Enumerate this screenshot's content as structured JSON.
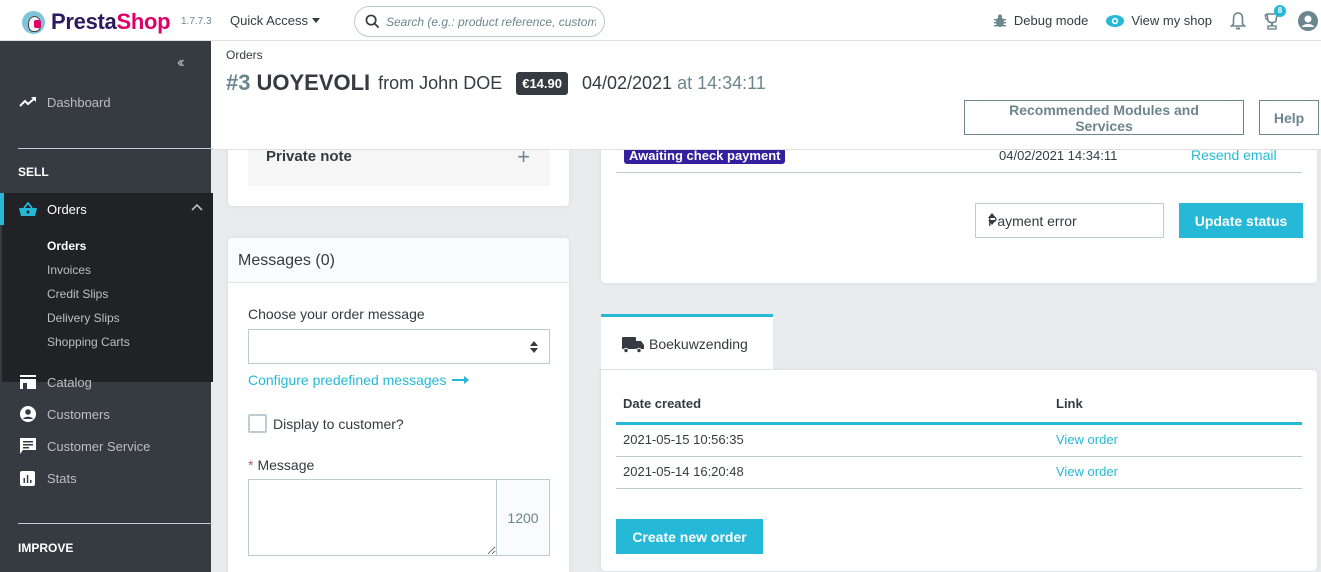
{
  "header": {
    "logo_brand": "Presta",
    "logo_brand_accent": "Shop",
    "version": "1.7.7.3",
    "quick_access": "Quick Access",
    "search_placeholder": "Search (e.g.: product reference, customer name…)",
    "debug_mode": "Debug mode",
    "view_shop": "View my shop",
    "notifications_badge": "8"
  },
  "sidebar": {
    "collapse_icon": "double-chevron-left",
    "dashboard": "Dashboard",
    "sell_title": "SELL",
    "orders": "Orders",
    "orders_sub": [
      "Orders",
      "Invoices",
      "Credit Slips",
      "Delivery Slips",
      "Shopping Carts"
    ],
    "catalog": "Catalog",
    "customers": "Customers",
    "customer_service": "Customer Service",
    "stats": "Stats",
    "improve_title": "IMPROVE"
  },
  "page": {
    "breadcrumb": "Orders",
    "order_number": "#3",
    "order_reference": "UOYEVOLI",
    "from_customer": "from John DOE",
    "total": "€14.90",
    "date": "04/02/2021",
    "time": "at 14:34:11",
    "btn_recommended": "Recommended Modules and Services",
    "btn_help": "Help"
  },
  "private_note": {
    "title": "Private note",
    "add_icon": "+"
  },
  "messages": {
    "title": "Messages (0)",
    "choose_label": "Choose your order message",
    "choose_value": "",
    "configure_link": "Configure predefined messages",
    "display_checkbox_label": "Display to customer?",
    "display_checked": false,
    "message_required": "*",
    "message_label": "Message",
    "message_value": "",
    "char_counter": "1200"
  },
  "status": {
    "current_status": "Awaiting check payment",
    "status_color": "#34209e",
    "status_date": "04/02/2021 14:34:11",
    "resend_link": "Resend email",
    "select_value": "Payment error",
    "update_button": "Update status"
  },
  "shipping": {
    "tab_label": "Boekuwzending",
    "columns": [
      "Date created",
      "Link"
    ],
    "rows": [
      {
        "date": "2021-05-15 10:56:35",
        "link": "View order"
      },
      {
        "date": "2021-05-14 16:20:48",
        "link": "View order"
      }
    ],
    "create_button": "Create new order"
  },
  "colors": {
    "accent": "#25b9d7",
    "sidebar_bg": "#363a41",
    "sidebar_active_bg": "#202226",
    "brand_pink": "#df0067",
    "brand_dark": "#2a1b5e"
  }
}
